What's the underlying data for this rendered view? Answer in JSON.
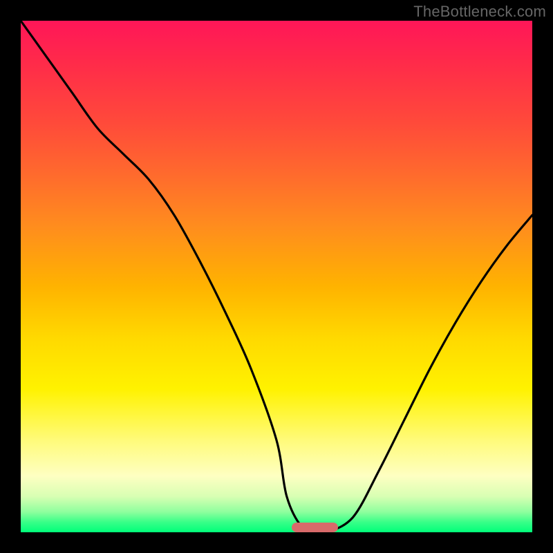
{
  "watermark": "TheBottleneck.com",
  "chart_data": {
    "type": "line",
    "title": "",
    "xlabel": "",
    "ylabel": "",
    "xlim": [
      0,
      100
    ],
    "ylim": [
      0,
      100
    ],
    "grid": false,
    "legend": false,
    "x": [
      0,
      5,
      10,
      15,
      20,
      25,
      30,
      35,
      40,
      45,
      50,
      52,
      55,
      58,
      60,
      65,
      70,
      75,
      80,
      85,
      90,
      95,
      100
    ],
    "values": [
      100,
      93,
      86,
      79,
      74,
      69,
      62,
      53,
      43,
      32,
      18,
      7,
      1,
      0,
      0,
      3,
      12,
      22,
      32,
      41,
      49,
      56,
      62
    ],
    "marker_range_x": [
      53,
      62
    ],
    "background_gradient": {
      "top_color": "#ff1658",
      "mid_color": "#ffd900",
      "bottom_color": "#00ff7a"
    }
  },
  "colors": {
    "frame": "#000000",
    "curve": "#000000",
    "marker": "#d86a6a",
    "watermark_text": "#666666"
  }
}
